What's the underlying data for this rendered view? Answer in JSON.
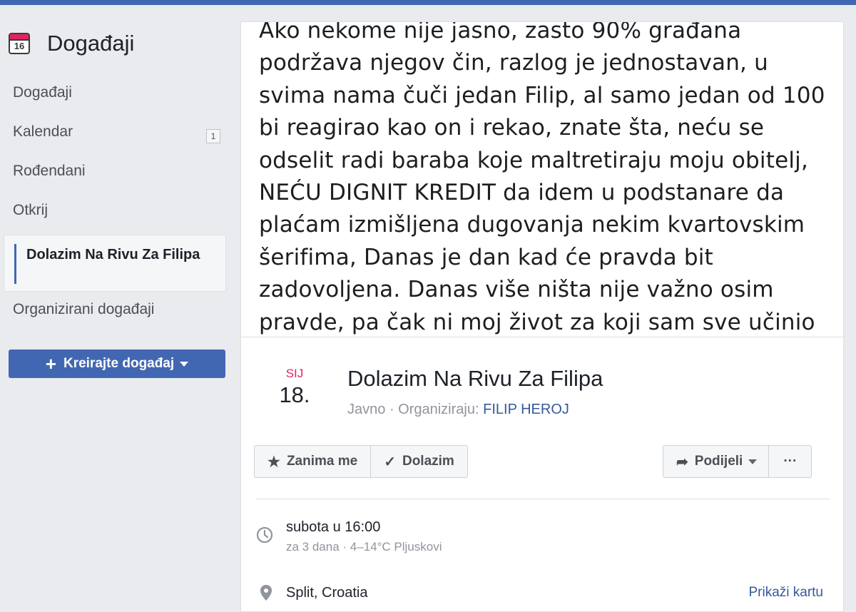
{
  "sidebar": {
    "title": "Događaji",
    "calendar_icon_day": "16",
    "items": [
      {
        "label": "Događaji"
      },
      {
        "label": "Kalendar",
        "badge": "1"
      },
      {
        "label": "Rođendani"
      },
      {
        "label": "Otkrij"
      },
      {
        "label": "Dolazim Na Rivu Za Filipa"
      },
      {
        "label": "Organizirani događaji"
      }
    ],
    "create_button": "Kreirajte događaj"
  },
  "cover": {
    "text": "Ako nekome nije jasno, zasto 90% građana podržava njegov čin, razlog je jednostavan, u svima nama čuči jedan Filip, al samo jedan od 100 bi reagirao kao on i rekao, znate šta, neću se odselit radi baraba koje maltretiraju moju obitelj, NEĆU DIGNIT KREDIT da idem u podstanare da plaćam izmišljena dugovanja nekim kvartovskim šerifima, Danas je dan kad će pravda bit zadovoljena. Danas više ništa nije važno osim pravde, pa čak ni moj život za koji sam sve učinio"
  },
  "event": {
    "month": "SIJ",
    "day": "18.",
    "title": "Dolazim Na Rivu Za Filipa",
    "privacy": "Javno",
    "organized_by_label": "Organiziraju:",
    "organizer": "FILIP HEROJ"
  },
  "actions": {
    "interested": "Zanima me",
    "going": "Dolazim",
    "share": "Podijeli",
    "more": "···"
  },
  "details": {
    "time": "subota u 16:00",
    "time_sub": "za 3 dana · 4–14°C Pljuskovi",
    "location": "Split, Croatia",
    "map_link": "Prikaži kartu"
  },
  "colors": {
    "brand": "#4267b2",
    "month": "#e0245e",
    "link": "#365899"
  }
}
